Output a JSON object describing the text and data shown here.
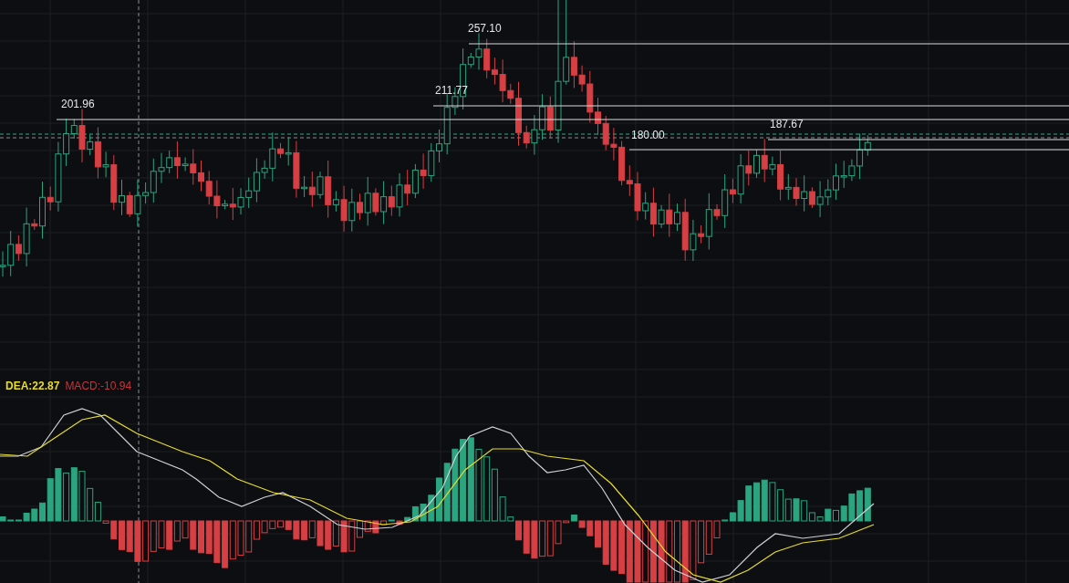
{
  "price_levels": [
    {
      "label": "257.10"
    },
    {
      "label": "211.77"
    },
    {
      "label": "201.96"
    },
    {
      "label": "180.00"
    },
    {
      "label": "187.67"
    }
  ],
  "indicator_legend": [
    {
      "text": "DEA:22.87",
      "color": "#e8dc2c"
    },
    {
      "text": "MACD:-10.94",
      "color": "#c4363a"
    }
  ]
}
